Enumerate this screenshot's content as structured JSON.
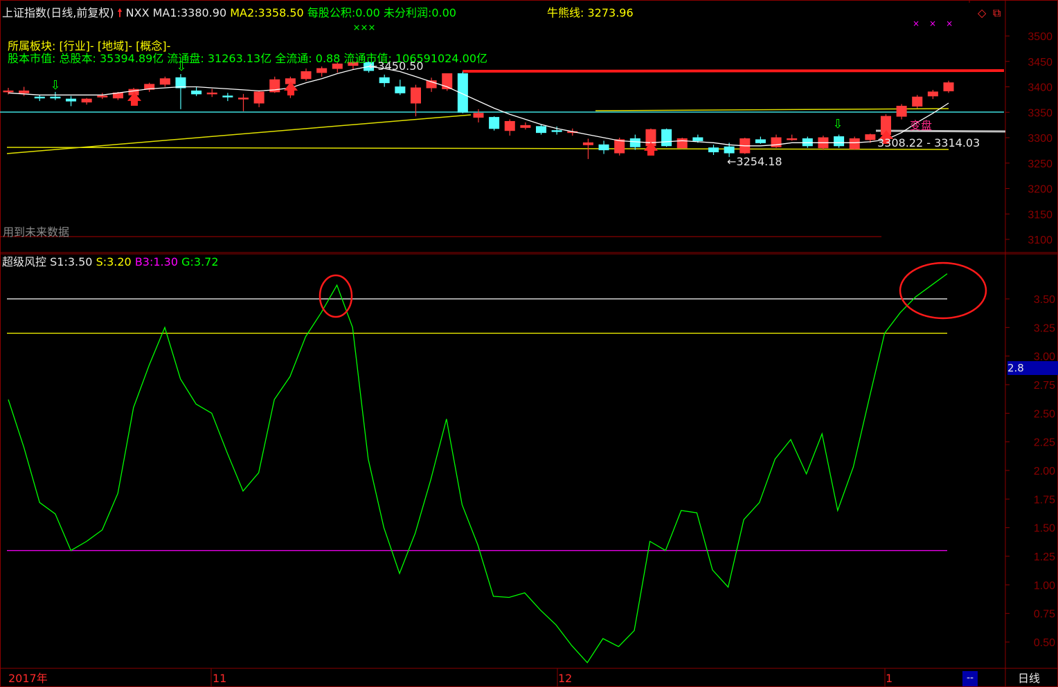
{
  "header": {
    "title": "上证指数(日线,前复权)",
    "code": "NXX",
    "ma1_label": "MA1:",
    "ma1_value": "3380.90",
    "ma2_label": "MA2:",
    "ma2_value": "3358.50",
    "eps_label": "每股公积:",
    "eps_value": "0.00",
    "undist_label": "未分利润:",
    "undist_value": "0.00",
    "bull_label": "牛熊线:",
    "bull_value": "3273.96",
    "sector_line": "所属板块: [行业]- [地域]- [概念]-",
    "capital_line": "股本市值: 总股本: 35394.89亿 流通盘: 31263.13亿 全流通: 0.88 流通市值: 106591024.00亿",
    "future_data_note": "用到未来数据"
  },
  "indicator_header": {
    "name": "超级风控",
    "s1_label": "S1:",
    "s1_value": "3.50",
    "s_label": "S:",
    "s_value": "3.20",
    "b3_label": "B3:",
    "b3_value": "1.30",
    "g_label": "G:",
    "g_value": "3.72"
  },
  "annotations": {
    "high_marker": "3450.50",
    "low_marker": "3254.18",
    "range_text": "3308.22 - 3314.03",
    "change_text": "变盘",
    "cursor_value": "2.8"
  },
  "bottom_bar": {
    "year_label": "2017年",
    "month_nov": "11",
    "month_dec": "12",
    "month_jan": "1",
    "dash_btn": "--",
    "period_btn": "日线"
  },
  "colors": {
    "up": "#ff3b3b",
    "down": "#54ffff",
    "grid": "#8b0000",
    "ma1": "#ffffff",
    "ma2": "#ffff00",
    "indicator": "#00ff00",
    "s1_line": "#ffffff",
    "s_line": "#ffff00",
    "b3_line": "#ff00ff"
  },
  "chart_data": [
    {
      "type": "candlestick",
      "ylim": [
        3075,
        3525
      ],
      "yticks": [
        3100,
        3150,
        3200,
        3250,
        3300,
        3350,
        3400,
        3450,
        3500
      ],
      "candles": [
        {
          "o": 3390,
          "h": 3398,
          "l": 3385,
          "c": 3392
        },
        {
          "o": 3388,
          "h": 3400,
          "l": 3382,
          "c": 3392
        },
        {
          "o": 3380,
          "h": 3384,
          "l": 3372,
          "c": 3378
        },
        {
          "o": 3380,
          "h": 3390,
          "l": 3374,
          "c": 3378
        },
        {
          "o": 3376,
          "h": 3382,
          "l": 3362,
          "c": 3372
        },
        {
          "o": 3370,
          "h": 3378,
          "l": 3365,
          "c": 3376
        },
        {
          "o": 3382,
          "h": 3388,
          "l": 3376,
          "c": 3382
        },
        {
          "o": 3378,
          "h": 3390,
          "l": 3374,
          "c": 3388
        },
        {
          "o": 3384,
          "h": 3398,
          "l": 3380,
          "c": 3395
        },
        {
          "o": 3395,
          "h": 3408,
          "l": 3390,
          "c": 3405
        },
        {
          "o": 3405,
          "h": 3420,
          "l": 3400,
          "c": 3416
        },
        {
          "o": 3418,
          "h": 3425,
          "l": 3356,
          "c": 3398
        },
        {
          "o": 3392,
          "h": 3400,
          "l": 3382,
          "c": 3386
        },
        {
          "o": 3386,
          "h": 3396,
          "l": 3380,
          "c": 3388
        },
        {
          "o": 3382,
          "h": 3388,
          "l": 3372,
          "c": 3380
        },
        {
          "o": 3378,
          "h": 3386,
          "l": 3352,
          "c": 3378
        },
        {
          "o": 3368,
          "h": 3392,
          "l": 3360,
          "c": 3390
        },
        {
          "o": 3390,
          "h": 3420,
          "l": 3388,
          "c": 3414
        },
        {
          "o": 3406,
          "h": 3420,
          "l": 3378,
          "c": 3416
        },
        {
          "o": 3416,
          "h": 3436,
          "l": 3412,
          "c": 3430
        },
        {
          "o": 3428,
          "h": 3440,
          "l": 3420,
          "c": 3436
        },
        {
          "o": 3436,
          "h": 3448,
          "l": 3428,
          "c": 3445
        },
        {
          "o": 3442,
          "h": 3450,
          "l": 3434,
          "c": 3448
        },
        {
          "o": 3448,
          "h": 3450,
          "l": 3428,
          "c": 3432
        },
        {
          "o": 3418,
          "h": 3424,
          "l": 3400,
          "c": 3408
        },
        {
          "o": 3400,
          "h": 3414,
          "l": 3384,
          "c": 3388
        },
        {
          "o": 3368,
          "h": 3404,
          "l": 3342,
          "c": 3398
        },
        {
          "o": 3398,
          "h": 3418,
          "l": 3390,
          "c": 3412
        },
        {
          "o": 3396,
          "h": 3426,
          "l": 3392,
          "c": 3426
        },
        {
          "o": 3426,
          "h": 3430,
          "l": 3348,
          "c": 3350
        },
        {
          "o": 3340,
          "h": 3356,
          "l": 3330,
          "c": 3348
        },
        {
          "o": 3340,
          "h": 3342,
          "l": 3314,
          "c": 3318
        },
        {
          "o": 3314,
          "h": 3336,
          "l": 3304,
          "c": 3332
        },
        {
          "o": 3320,
          "h": 3330,
          "l": 3316,
          "c": 3324
        },
        {
          "o": 3322,
          "h": 3326,
          "l": 3306,
          "c": 3310
        },
        {
          "o": 3314,
          "h": 3322,
          "l": 3306,
          "c": 3312
        },
        {
          "o": 3310,
          "h": 3318,
          "l": 3304,
          "c": 3312
        },
        {
          "o": 3286,
          "h": 3298,
          "l": 3258,
          "c": 3290
        },
        {
          "o": 3286,
          "h": 3294,
          "l": 3268,
          "c": 3276
        },
        {
          "o": 3270,
          "h": 3300,
          "l": 3265,
          "c": 3296
        },
        {
          "o": 3298,
          "h": 3306,
          "l": 3276,
          "c": 3282
        },
        {
          "o": 3284,
          "h": 3318,
          "l": 3280,
          "c": 3316
        },
        {
          "o": 3316,
          "h": 3318,
          "l": 3282,
          "c": 3284
        },
        {
          "o": 3280,
          "h": 3300,
          "l": 3278,
          "c": 3298
        },
        {
          "o": 3300,
          "h": 3306,
          "l": 3290,
          "c": 3294
        },
        {
          "o": 3280,
          "h": 3286,
          "l": 3266,
          "c": 3272
        },
        {
          "o": 3282,
          "h": 3290,
          "l": 3262,
          "c": 3270
        },
        {
          "o": 3270,
          "h": 3300,
          "l": 3268,
          "c": 3298
        },
        {
          "o": 3296,
          "h": 3302,
          "l": 3288,
          "c": 3290
        },
        {
          "o": 3282,
          "h": 3306,
          "l": 3280,
          "c": 3300
        },
        {
          "o": 3298,
          "h": 3306,
          "l": 3294,
          "c": 3298
        },
        {
          "o": 3298,
          "h": 3302,
          "l": 3280,
          "c": 3284
        },
        {
          "o": 3280,
          "h": 3304,
          "l": 3276,
          "c": 3300
        },
        {
          "o": 3302,
          "h": 3306,
          "l": 3280,
          "c": 3284
        },
        {
          "o": 3278,
          "h": 3302,
          "l": 3276,
          "c": 3298
        },
        {
          "o": 3296,
          "h": 3308,
          "l": 3290,
          "c": 3306
        },
        {
          "o": 3306,
          "h": 3346,
          "l": 3304,
          "c": 3342
        },
        {
          "o": 3342,
          "h": 3366,
          "l": 3336,
          "c": 3362
        },
        {
          "o": 3362,
          "h": 3384,
          "l": 3358,
          "c": 3380
        },
        {
          "o": 3382,
          "h": 3394,
          "l": 3376,
          "c": 3390
        },
        {
          "o": 3392,
          "h": 3412,
          "l": 3388,
          "c": 3408
        }
      ],
      "ma1": [
        3388,
        3386,
        3384,
        3384,
        3384,
        3384,
        3384,
        3388,
        3392,
        3396,
        3398,
        3400,
        3400,
        3398,
        3396,
        3394,
        3392,
        3394,
        3398,
        3408,
        3416,
        3426,
        3434,
        3440,
        3436,
        3430,
        3420,
        3410,
        3400,
        3386,
        3372,
        3358,
        3346,
        3336,
        3326,
        3318,
        3312,
        3306,
        3300,
        3294,
        3292,
        3290,
        3292,
        3294,
        3292,
        3290,
        3286,
        3284,
        3284,
        3286,
        3290,
        3290,
        3290,
        3290,
        3290,
        3292,
        3296,
        3310,
        3330,
        3348,
        3368
      ]
    },
    {
      "type": "line",
      "ylim": [
        0.25,
        3.9
      ],
      "yticks": [
        0.5,
        0.75,
        1.0,
        1.25,
        1.5,
        1.75,
        2.0,
        2.25,
        2.5,
        2.75,
        3.0,
        3.25,
        3.5
      ],
      "levels": {
        "S1": 3.5,
        "S": 3.2,
        "B3": 1.3
      },
      "G": [
        2.62,
        2.2,
        1.72,
        1.62,
        1.3,
        1.38,
        1.48,
        1.8,
        2.55,
        2.92,
        3.25,
        2.8,
        2.58,
        2.5,
        2.15,
        1.82,
        1.98,
        2.62,
        2.82,
        3.17,
        3.38,
        3.62,
        3.25,
        2.1,
        1.5,
        1.1,
        1.45,
        1.92,
        2.45,
        1.7,
        1.35,
        0.9,
        0.89,
        0.93,
        0.78,
        0.65,
        0.47,
        0.32,
        0.53,
        0.46,
        0.6,
        1.38,
        1.3,
        1.65,
        1.63,
        1.13,
        0.98,
        1.57,
        1.72,
        2.1,
        2.27,
        1.97,
        2.32,
        1.65,
        2.03,
        2.62,
        3.2,
        3.38,
        3.52,
        3.62,
        3.72
      ]
    }
  ]
}
